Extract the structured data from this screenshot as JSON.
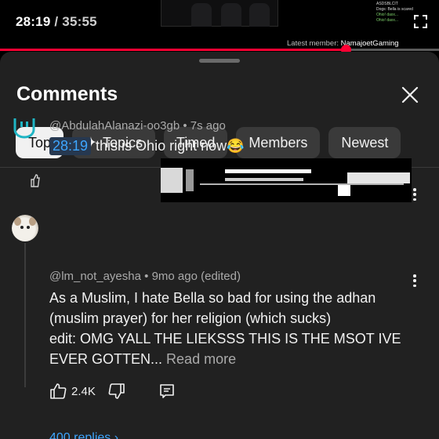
{
  "player": {
    "current_time": "28:19",
    "separator": "/",
    "duration": "35:55",
    "progress_fraction": 0.788,
    "chat_lines": [
      "ASDSBLCIT",
      "Dogs: Bella is scared",
      "Ohio! daxx...",
      "Ohio! daxx..."
    ],
    "latest_member_label": "Latest member:",
    "latest_member_name": "NamajoetGaming"
  },
  "sheet": {
    "title": "Comments",
    "chips": [
      {
        "label": "Top",
        "active": true
      },
      {
        "label": "Topics",
        "icon": "sparkle-icon"
      },
      {
        "label": "Timed"
      },
      {
        "label": "Members"
      },
      {
        "label": "Newest"
      }
    ]
  },
  "comments": [
    {
      "author": "@AbdulahAlanazi-oo3gb",
      "dot": "•",
      "age": "7s ago",
      "timestamp": "28:19",
      "text": "this is Ohio right now😂"
    },
    {
      "author": "@lm_not_ayesha",
      "dot": "•",
      "age": "9mo ago (edited)",
      "line1": "As a Muslim, I hate Bella so bad for using the adhan",
      "line2": "(muslim prayer) for her religion (which sucks)",
      "line3": "edit: OMG YALL THE LIEKSSS THIS IS THE MSOT IVE",
      "line4": "EVER GOTTEN...",
      "read_more": "Read more",
      "likes": "2.4K",
      "replies": "400 replies ›"
    }
  ],
  "colors": {
    "accent_red": "#ff0033",
    "link_blue": "#3ea6ff",
    "sheet_bg": "#212121",
    "chip_bg": "#3a3a3a"
  }
}
